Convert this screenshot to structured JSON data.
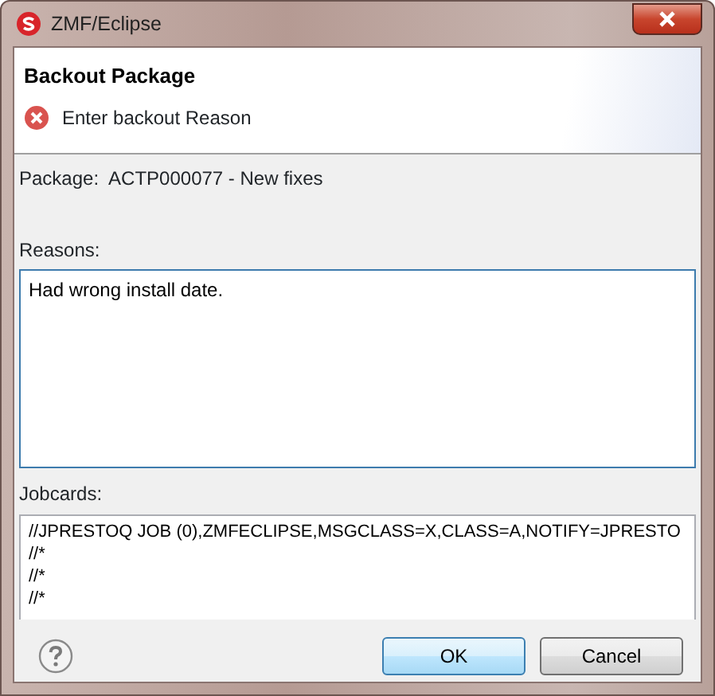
{
  "window": {
    "title": "ZMF/Eclipse"
  },
  "header": {
    "title": "Backout Package",
    "message": {
      "kind": "error",
      "text": "Enter backout Reason"
    }
  },
  "package": {
    "label": "Package:",
    "value": "ACTP000077 - New fixes"
  },
  "reasons": {
    "label": "Reasons:",
    "value": "Had wrong install date.",
    "focused": true
  },
  "jobcards": {
    "label": "Jobcards:",
    "lines": [
      "//JPRESTOQ JOB (0),ZMFECLIPSE,MSGCLASS=X,CLASS=A,NOTIFY=JPRESTO",
      "//*",
      "//*",
      "//*"
    ]
  },
  "buttons": [
    {
      "label": "OK",
      "default": true
    },
    {
      "label": "Cancel",
      "default": false
    }
  ]
}
